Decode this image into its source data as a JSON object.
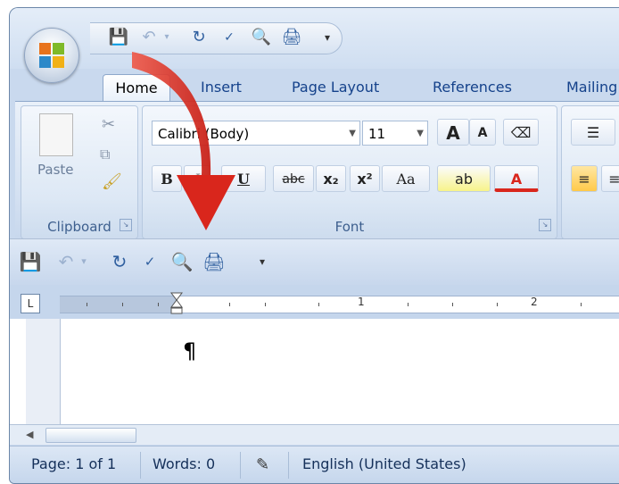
{
  "tabs": [
    "Home",
    "Insert",
    "Page Layout",
    "References",
    "Mailing"
  ],
  "clipboard": {
    "paste_label": "Paste",
    "group_label": "Clipboard"
  },
  "font": {
    "font_name": "Calibri (Body)",
    "font_size": "11",
    "group_label": "Font",
    "grow": "A",
    "shrink": "A",
    "bold": "B",
    "italic": "I",
    "underline": "U",
    "strike": "abc",
    "subscript": "x₂",
    "superscript": "x²",
    "change_case": "Aa",
    "highlight": "ab",
    "font_color": "A"
  },
  "document": {
    "pilcrow": "¶"
  },
  "ruler": {
    "marks": [
      "1",
      "2"
    ]
  },
  "status": {
    "page": "Page: 1 of 1",
    "words": "Words: 0",
    "language": "English (United States)"
  },
  "icons": {
    "office_button": "office-logo-icon",
    "save": "save-icon",
    "undo": "undo-icon",
    "redo": "redo-icon",
    "spelling": "spelling-icon",
    "print_preview": "print-preview-icon",
    "print": "print-icon",
    "customize": "customize-arrow-icon",
    "arrow": "red-curved-arrow"
  },
  "colors": {
    "ribbon": "#d7e3f3",
    "arrow": "#d9261c",
    "text_blue": "#15428b"
  }
}
